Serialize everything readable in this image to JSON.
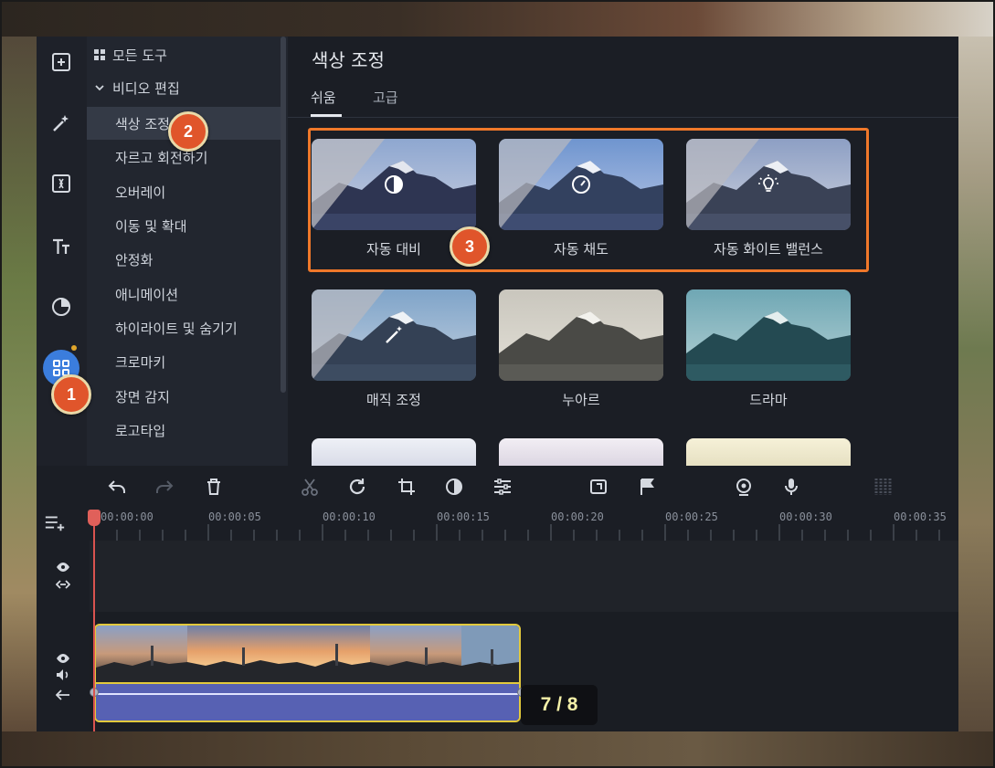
{
  "rail": {
    "items": [
      {
        "name": "import-icon"
      },
      {
        "name": "magic-wand-icon"
      },
      {
        "name": "transitions-icon"
      },
      {
        "name": "titles-icon"
      },
      {
        "name": "stickers-icon"
      },
      {
        "name": "more-tools-icon",
        "active": true
      }
    ]
  },
  "tools": {
    "all_tools": "모든 도구",
    "section": "비디오 편집",
    "items": [
      "색상 조정",
      "자르고 회전하기",
      "오버레이",
      "이동 및 확대",
      "안정화",
      "애니메이션",
      "하이라이트 및 숨기기",
      "크로마키",
      "장면 감지",
      "로고타입"
    ],
    "selected_index": 0
  },
  "panel": {
    "title": "색상 조정",
    "tabs": [
      "쉬움",
      "고급"
    ],
    "active_tab": 0,
    "presets": [
      {
        "label": "자동 대비",
        "icon": "contrast-icon"
      },
      {
        "label": "자동 채도",
        "icon": "gauge-icon"
      },
      {
        "label": "자동 화이트 밸런스",
        "icon": "lightbulb-icon"
      },
      {
        "label": "매직 조정",
        "icon": "magic-wand-icon"
      },
      {
        "label": "누아르",
        "icon": ""
      },
      {
        "label": "드라마",
        "icon": ""
      }
    ]
  },
  "badges": [
    "1",
    "2",
    "3"
  ],
  "toolbar": {
    "icons": [
      "undo-icon",
      "redo-icon",
      "delete-icon",
      "cut-icon",
      "rotate-icon",
      "crop-icon",
      "color-icon",
      "adjust-icon",
      "crop-zoom-icon",
      "marker-flag-icon",
      "webcam-icon",
      "microphone-icon",
      "audio-levels-icon"
    ]
  },
  "timeline": {
    "ticks": [
      "00:00:00",
      "00:00:05",
      "00:00:10",
      "00:00:15",
      "00:00:20",
      "00:00:25",
      "00:00:30",
      "00:00:35"
    ],
    "counter": "7 / 8"
  },
  "colors": {
    "accent": "#3b7ddd",
    "highlight": "#f0782a",
    "badge": "#e0552b",
    "clip_border": "#e2c93c",
    "audio": "#5761b3",
    "playhead": "#d9534f"
  }
}
